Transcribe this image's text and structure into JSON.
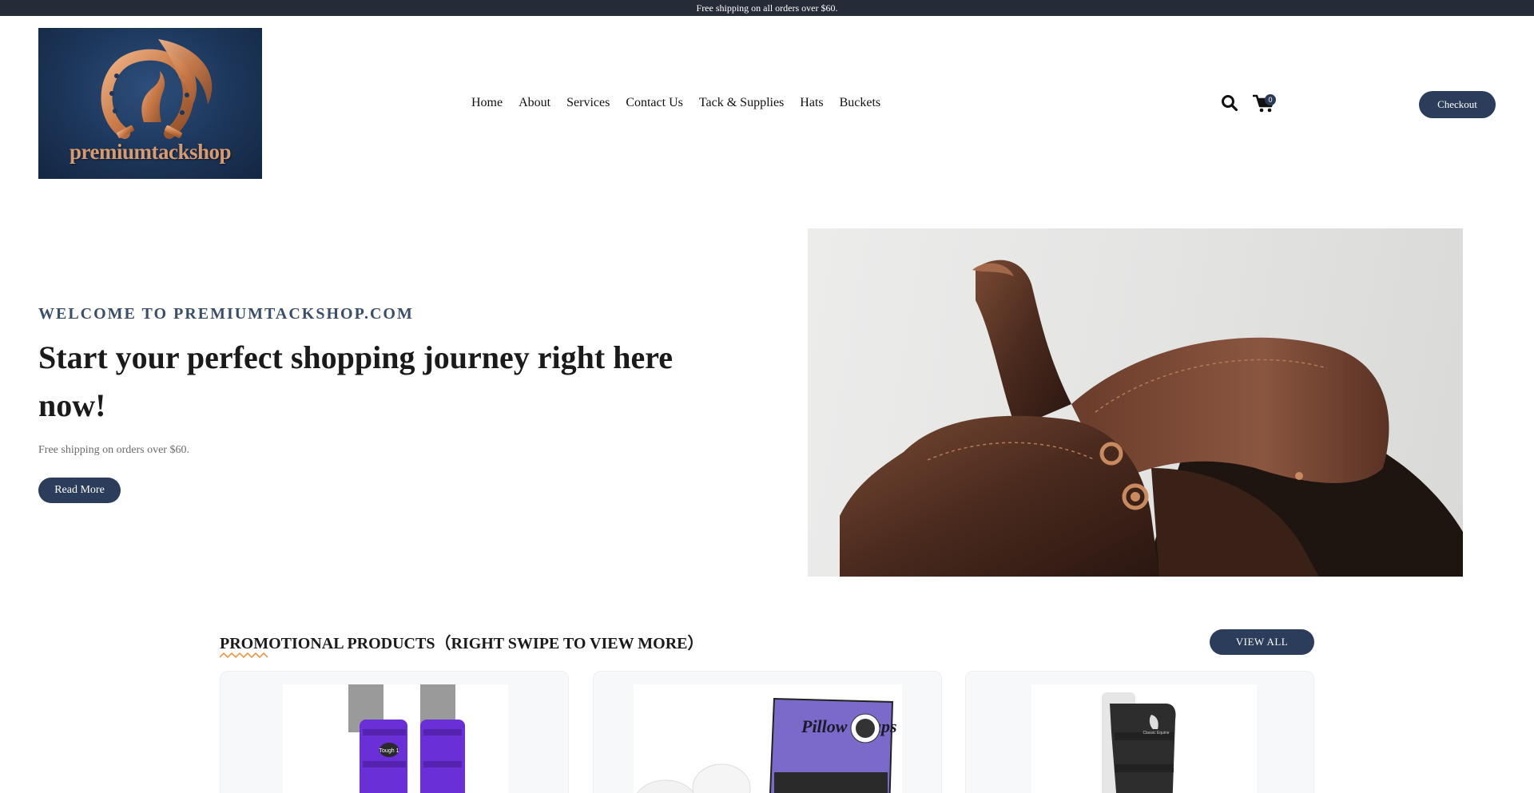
{
  "announcement": "Free shipping on all orders over $60.",
  "brand": {
    "logo_text": "premiumtackshop"
  },
  "nav": {
    "items": [
      "Home",
      "About",
      "Services",
      "Contact Us",
      "Tack & Supplies",
      "Hats",
      "Buckets"
    ]
  },
  "header_actions": {
    "cart_count": "0",
    "checkout_label": "Checkout"
  },
  "hero": {
    "kicker": "WELCOME TO PREMIUMTACKSHOP.COM",
    "title": "Start your perfect shopping journey right here now!",
    "subtitle": "Free shipping on orders over $60.",
    "button_label": "Read More"
  },
  "promo": {
    "title": "PROMOTIONAL PRODUCTS（RIGHT SWIPE TO VIEW MORE）",
    "view_all_label": "VIEW ALL",
    "products": [
      {
        "image_label": "Tough 1"
      },
      {
        "image_label": "Pillow Wraps"
      },
      {
        "image_label": "Classic Equine"
      }
    ]
  },
  "colors": {
    "topbar": "#262b38",
    "button": "#2b3d5a",
    "accent": "#e89a4a"
  }
}
